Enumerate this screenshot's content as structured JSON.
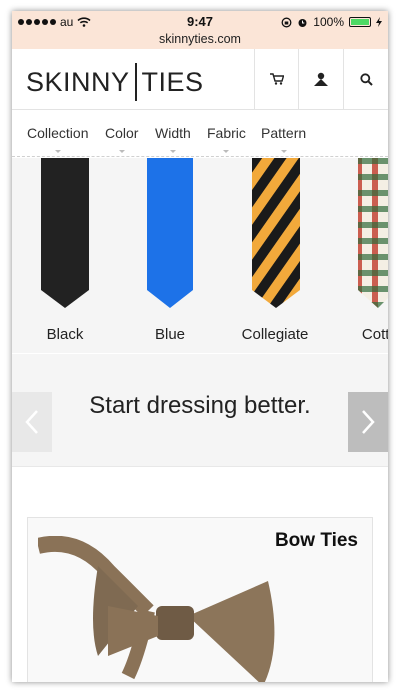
{
  "status_bar": {
    "carrier": "au",
    "time": "9:47",
    "battery": "100%",
    "url": "skinnyties.com"
  },
  "header": {
    "logo_left": "SKINNY",
    "logo_right": "TIES",
    "icons": [
      "cart-icon",
      "account-icon",
      "search-icon"
    ]
  },
  "nav": {
    "items": [
      "Collection",
      "Color",
      "Width",
      "Fabric",
      "Pattern"
    ]
  },
  "ties": {
    "items": [
      {
        "label": "Black"
      },
      {
        "label": "Blue"
      },
      {
        "label": "Collegiate"
      },
      {
        "label": "Cotton"
      }
    ],
    "colors": {
      "black": "#222222",
      "blue": "#1d72e8",
      "gold": "#f2a93b",
      "plaid_red": "#c0392b",
      "plaid_green": "#2f6b3a"
    }
  },
  "banner": {
    "message": "Start dressing better."
  },
  "card": {
    "title": "Bow Ties"
  }
}
